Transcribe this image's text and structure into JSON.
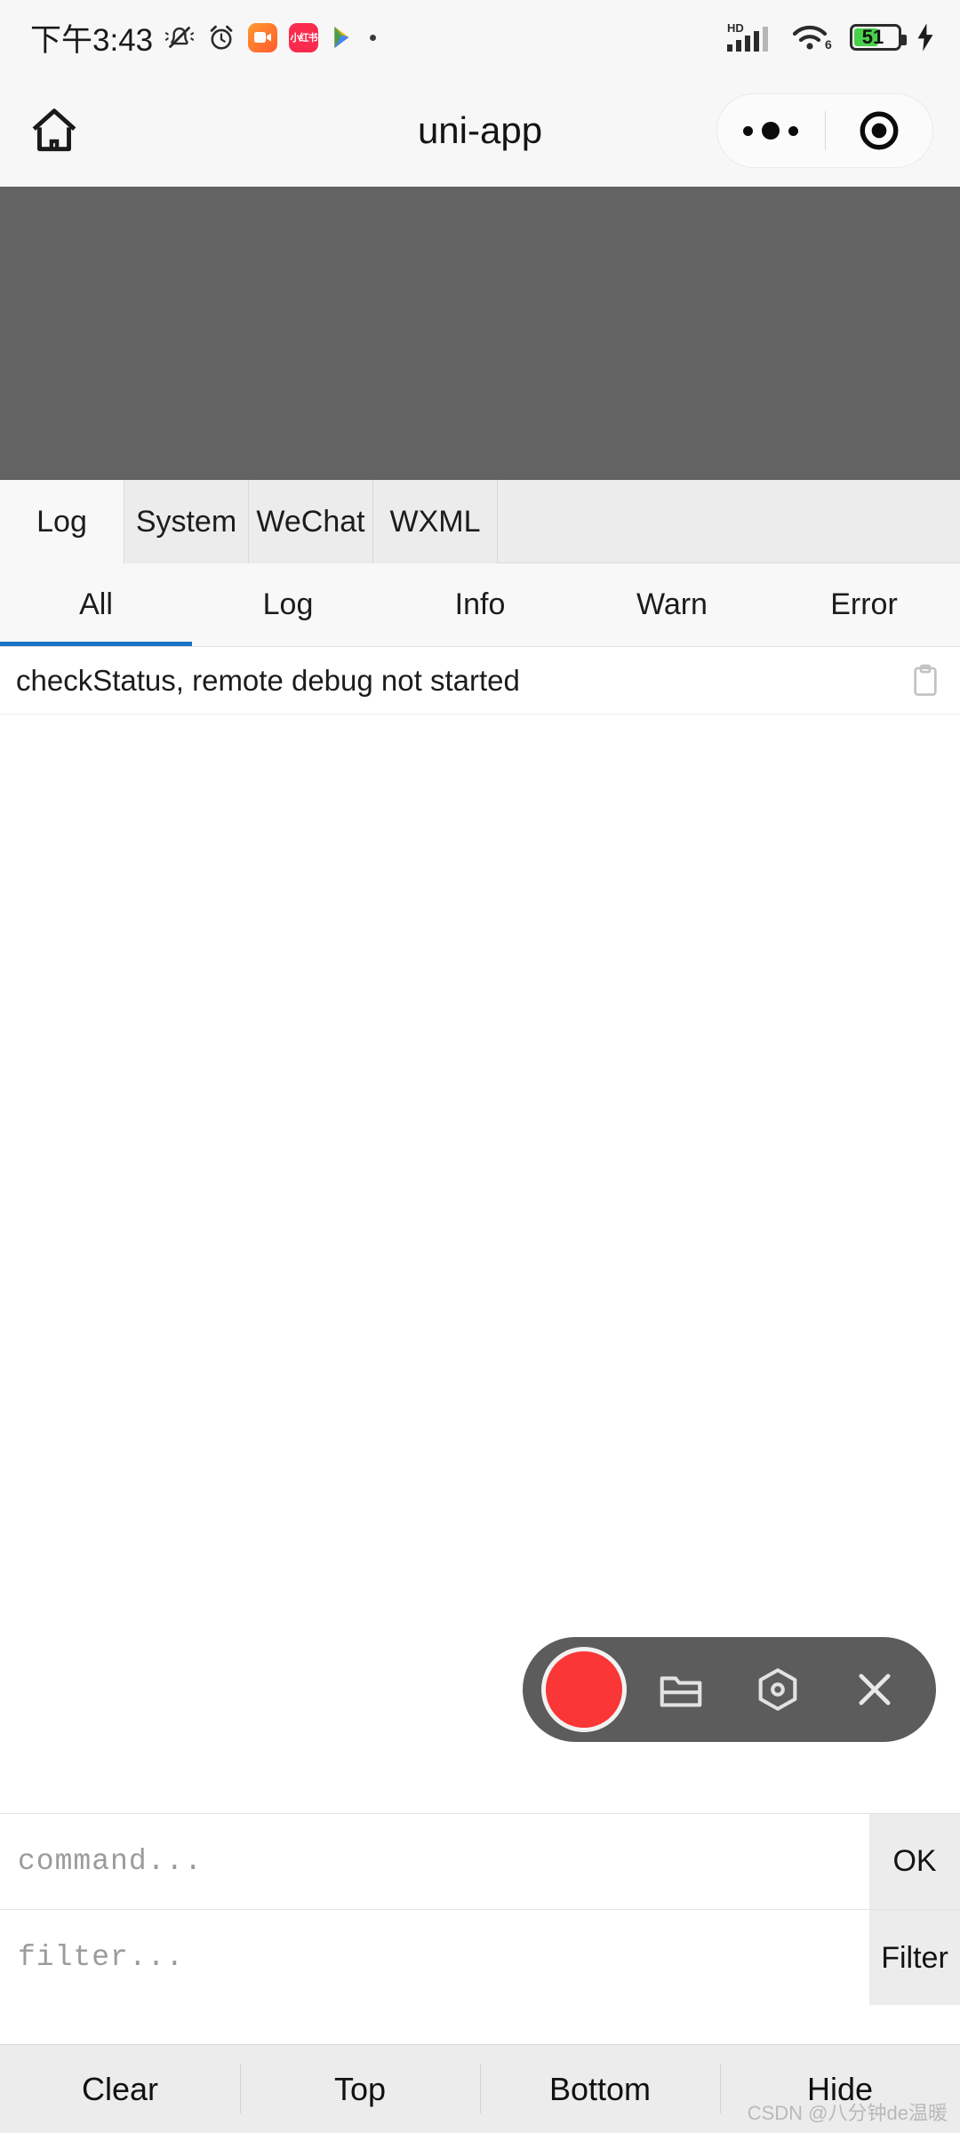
{
  "status_bar": {
    "time": "下午3:43",
    "icons": [
      {
        "name": "mute-bell-icon",
        "label": "mute"
      },
      {
        "name": "alarm-clock-icon",
        "label": "alarm"
      },
      {
        "name": "video-app-icon",
        "label": "video"
      },
      {
        "name": "xiaohongshu-app-icon",
        "label": "小红书"
      },
      {
        "name": "play-store-icon",
        "label": "play"
      },
      {
        "name": "more-dot-icon",
        "label": "•"
      }
    ],
    "hd_label": "HD",
    "wifi_generation": "6",
    "battery_percent": "51",
    "charging": true,
    "bg_color": "#f7f7f7"
  },
  "nav_bar": {
    "home_icon": "home-icon",
    "title": "uni-app",
    "capsule": {
      "more_icon": "more-dots-icon",
      "target_icon": "target-circle-icon"
    }
  },
  "webview": {
    "bg_color": "#636363"
  },
  "console": {
    "source_tabs": [
      {
        "label": "Log",
        "active": true
      },
      {
        "label": "System",
        "active": false
      },
      {
        "label": "WeChat",
        "active": false
      },
      {
        "label": "WXML",
        "active": false
      }
    ],
    "level_tabs": [
      {
        "label": "All",
        "active": true
      },
      {
        "label": "Log",
        "active": false
      },
      {
        "label": "Info",
        "active": false
      },
      {
        "label": "Warn",
        "active": false
      },
      {
        "label": "Error",
        "active": false
      }
    ],
    "active_underline_color": "#1a73c8",
    "log_entries": [
      {
        "message": "checkStatus, remote debug not started",
        "copy_icon": "clipboard-icon"
      }
    ]
  },
  "floating_toolbar": {
    "bg_color": "#5c5c5c",
    "record_color": "#fa3636",
    "buttons": [
      {
        "name": "record-button",
        "icon": "record-circle-icon"
      },
      {
        "name": "folder-button",
        "icon": "folder-icon"
      },
      {
        "name": "settings-button",
        "icon": "hexagon-settings-icon"
      },
      {
        "name": "close-button",
        "icon": "close-x-icon"
      }
    ]
  },
  "inputs": {
    "command": {
      "placeholder": "command...",
      "value": "",
      "button_label": "OK"
    },
    "filter": {
      "placeholder": "filter...",
      "value": "",
      "button_label": "Filter"
    }
  },
  "action_bar": {
    "buttons": [
      {
        "label": "Clear"
      },
      {
        "label": "Top"
      },
      {
        "label": "Bottom"
      },
      {
        "label": "Hide"
      }
    ]
  },
  "watermark": {
    "text": "CSDN @八分钟de温暖"
  }
}
